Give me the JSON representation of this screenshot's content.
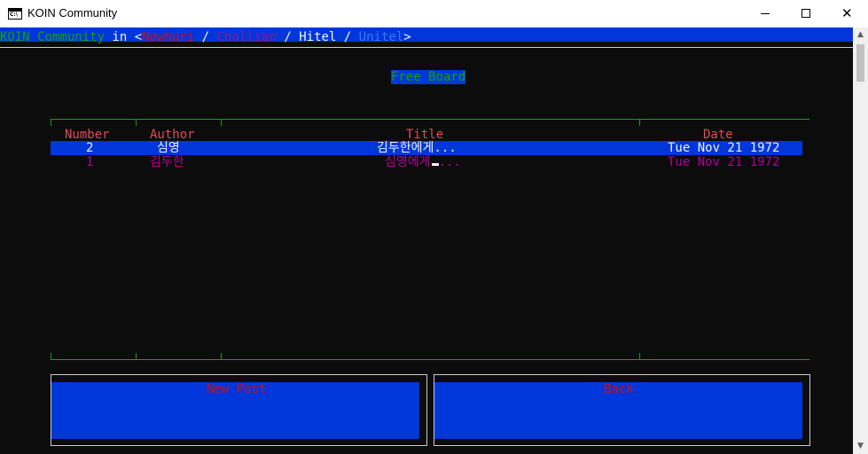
{
  "window": {
    "title": "KOIN Community",
    "icon_text": "C:\\",
    "controls": {
      "minimize": "minimize-icon",
      "maximize": "maximize-icon",
      "close": "✕"
    }
  },
  "header": {
    "app_name": "KOIN Community",
    "connector": " in <",
    "networks": [
      "Nowhuri",
      "Chollian",
      "Hitel",
      "Unitel"
    ],
    "separator": " / ",
    "close_bracket": ">"
  },
  "board": {
    "title": "Free Board",
    "columns": {
      "number": "Number",
      "author": "Author",
      "title": "Title",
      "date": "Date"
    },
    "posts": [
      {
        "number": "2",
        "author": "심영",
        "title": "김두한에게...",
        "date": "Tue Nov 21 1972",
        "selected": true
      },
      {
        "number": "1",
        "author": "김두한",
        "title_before_cursor": "심영에게",
        "title_after_cursor": "...",
        "date": "Tue Nov 21 1972",
        "selected": false
      }
    ]
  },
  "buttons": {
    "new_post": "New Post",
    "back": "Back"
  },
  "colors": {
    "console_bg": "#0c0c0c",
    "selection_blue": "#0037da",
    "grid_green": "#13a10e",
    "header_red": "#e74856",
    "label_red": "#c50f1f",
    "row_purple": "#b4009e",
    "text_white": "#cccccc"
  }
}
